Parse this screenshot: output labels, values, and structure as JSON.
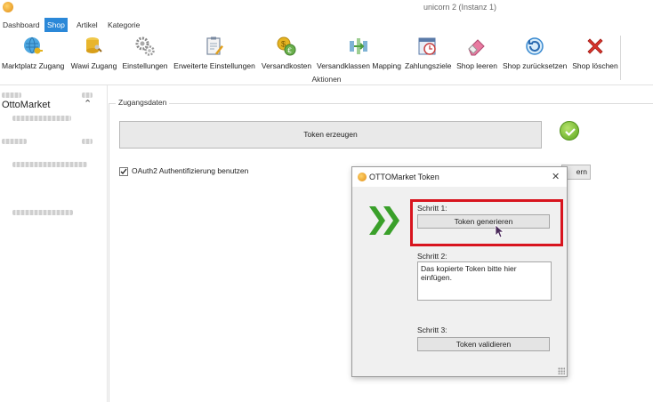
{
  "window": {
    "title": "unicorn 2 (Instanz 1)"
  },
  "tabs": [
    {
      "label": "Dashboard",
      "active": false
    },
    {
      "label": "Shop",
      "active": true
    },
    {
      "label": "Artikel",
      "active": false
    },
    {
      "label": "Kategorie",
      "active": false
    }
  ],
  "ribbon": {
    "group_label": "Aktionen",
    "buttons": [
      {
        "label": "Marktplatz Zugang",
        "icon": "globe-key-icon"
      },
      {
        "label": "Wawi Zugang",
        "icon": "database-key-icon"
      },
      {
        "label": "Einstellungen",
        "icon": "gears-icon"
      },
      {
        "label": "Erweiterte Einstellungen",
        "icon": "clipboard-edit-icon"
      },
      {
        "label": "Versandkosten",
        "icon": "coins-icon"
      },
      {
        "label": "Versandklassen Mapping",
        "icon": "mapping-icon"
      },
      {
        "label": "Zahlungsziele",
        "icon": "calendar-clock-icon"
      },
      {
        "label": "Shop leeren",
        "icon": "eraser-icon"
      },
      {
        "label": "Shop zurücksetzen",
        "icon": "reset-icon"
      },
      {
        "label": "Shop löschen",
        "icon": "delete-x-icon"
      }
    ]
  },
  "sidebar": {
    "section_title": "OttoMarket"
  },
  "main": {
    "group_title": "Zugangsdaten",
    "token_button": "Token erzeugen",
    "oauth_label": "OAuth2 Authentifizierung benutzen",
    "oauth_checked": true,
    "partial_button": "ern"
  },
  "dialog": {
    "title": "OTTOMarket Token",
    "close": "✕",
    "step1_label": "Schritt 1:",
    "step1_button": "Token generieren",
    "step2_label": "Schritt 2:",
    "step2_text": "Das kopierte Token bitte hier einfügen.",
    "step3_label": "Schritt 3:",
    "step3_button": "Token validieren"
  },
  "colors": {
    "accent": "#2b88d8",
    "highlight": "#d8141e",
    "success": "#5aa51c"
  }
}
